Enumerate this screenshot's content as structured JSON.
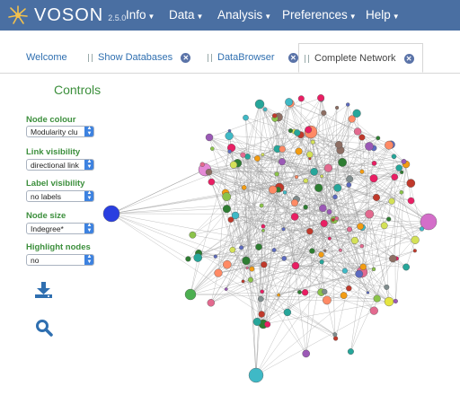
{
  "app": {
    "name": "VOSON",
    "version": "2.5.0"
  },
  "menu": [
    {
      "label": "Info"
    },
    {
      "label": "Data"
    },
    {
      "label": "Analysis"
    },
    {
      "label": "Preferences"
    },
    {
      "label": "Help"
    }
  ],
  "tabs": [
    {
      "label": "Welcome",
      "active": false,
      "closable": false
    },
    {
      "label": "Show Databases",
      "active": false,
      "closable": true
    },
    {
      "label": "DataBrowser",
      "active": false,
      "closable": true
    },
    {
      "label": "Complete Network",
      "active": true,
      "closable": true
    }
  ],
  "controls": {
    "title": "Controls",
    "node_colour": {
      "label": "Node colour",
      "value": "Modularity clu"
    },
    "link_visibility": {
      "label": "Link visibility",
      "value": "directional link"
    },
    "label_visibility": {
      "label": "Label visibility",
      "value": "no labels"
    },
    "node_size": {
      "label": "Node size",
      "value": "Indegree*"
    },
    "highlight_nodes": {
      "label": "Highlight nodes",
      "value": "no"
    },
    "download_icon": "download-icon",
    "search_icon": "search-icon"
  },
  "colors": {
    "navbar": "#4a6fa2",
    "accent_green": "#3c8f3c",
    "link_blue": "#2f6fb0",
    "select_blue": "#3d82e0"
  }
}
